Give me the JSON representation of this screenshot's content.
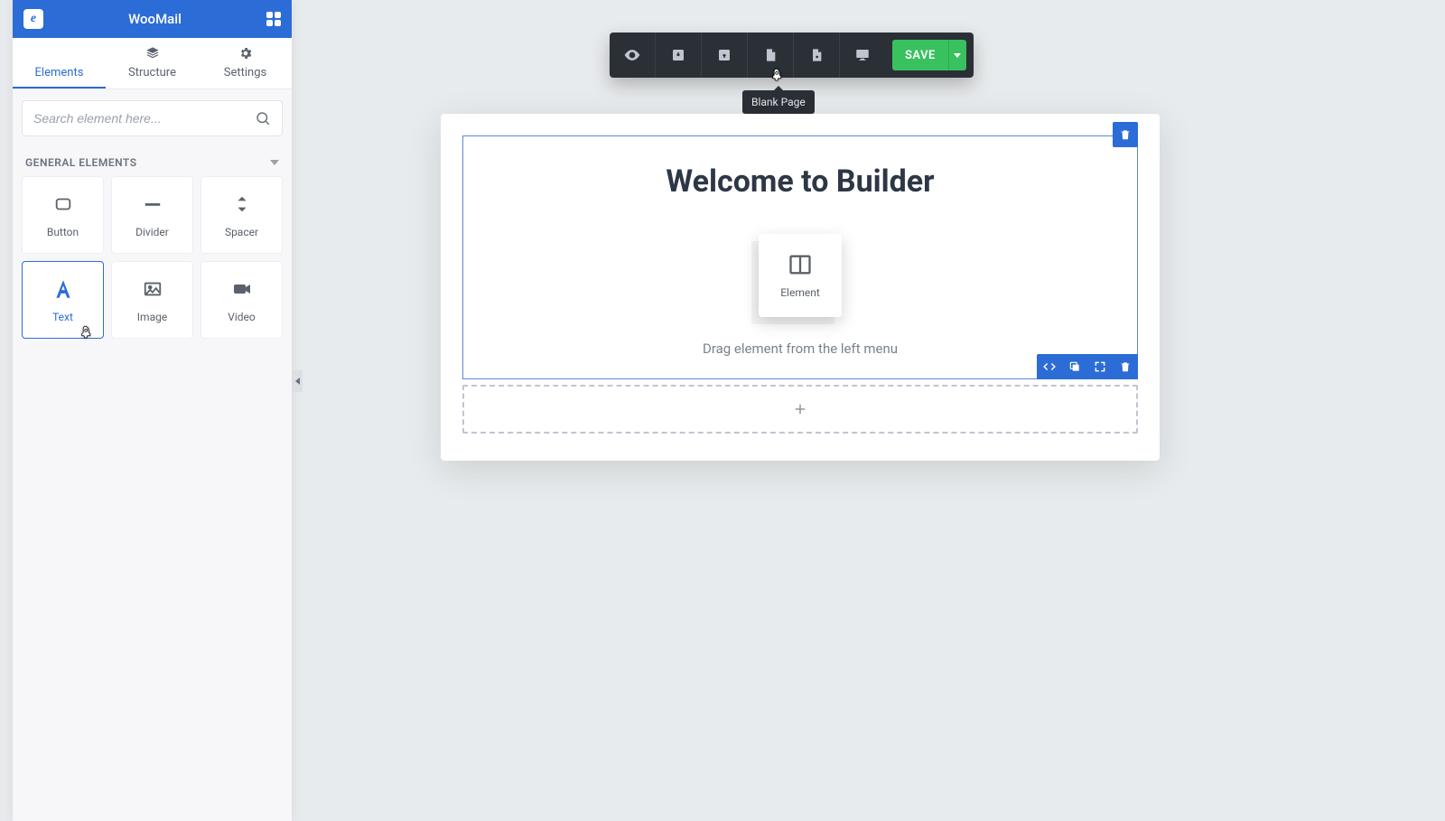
{
  "sidebar": {
    "appName": "WooMail",
    "logoLetter": "e",
    "tabs": {
      "elements": "Elements",
      "structure": "Structure",
      "settings": "Settings"
    },
    "search": {
      "placeholder": "Search element here..."
    },
    "sectionTitle": "GENERAL ELEMENTS",
    "elements": [
      {
        "id": "button",
        "label": "Button"
      },
      {
        "id": "divider",
        "label": "Divider"
      },
      {
        "id": "spacer",
        "label": "Spacer"
      },
      {
        "id": "text",
        "label": "Text"
      },
      {
        "id": "image",
        "label": "Image"
      },
      {
        "id": "video",
        "label": "Video"
      }
    ]
  },
  "toolbar": {
    "tooltip": "Blank Page",
    "saveLabel": "SAVE"
  },
  "canvas": {
    "heading": "Welcome to Builder",
    "elementCardLabel": "Element",
    "hint": "Drag element from the left menu"
  }
}
